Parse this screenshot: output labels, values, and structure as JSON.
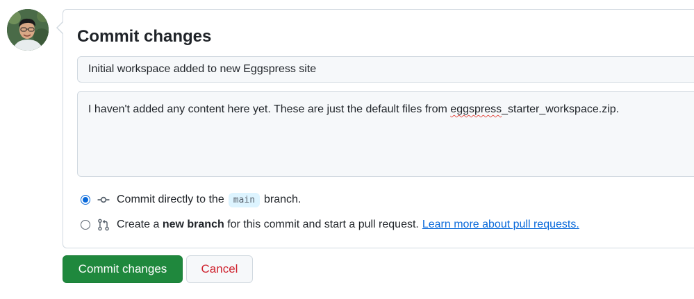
{
  "header": {
    "title": "Commit changes"
  },
  "commit": {
    "summary_value": "Initial workspace added to new Eggspress site",
    "description_before": "I haven't added any content here yet. These are just the default files from ",
    "description_misspelled": "eggspress",
    "description_after": "_starter_workspace.zip."
  },
  "options": {
    "direct": {
      "prefix": "Commit directly to the",
      "branch": "main",
      "suffix": "branch.",
      "selected": true,
      "icon": "git-commit-icon"
    },
    "new_branch": {
      "prefix": "Create a",
      "bold": "new branch",
      "suffix": "for this commit and start a pull request.",
      "link": "Learn more about pull requests.",
      "selected": false,
      "icon": "git-pull-request-icon"
    }
  },
  "buttons": {
    "commit": "Commit changes",
    "cancel": "Cancel"
  },
  "colors": {
    "accent": "#0969da",
    "primary_button": "#1f883d",
    "danger": "#cf222e"
  }
}
